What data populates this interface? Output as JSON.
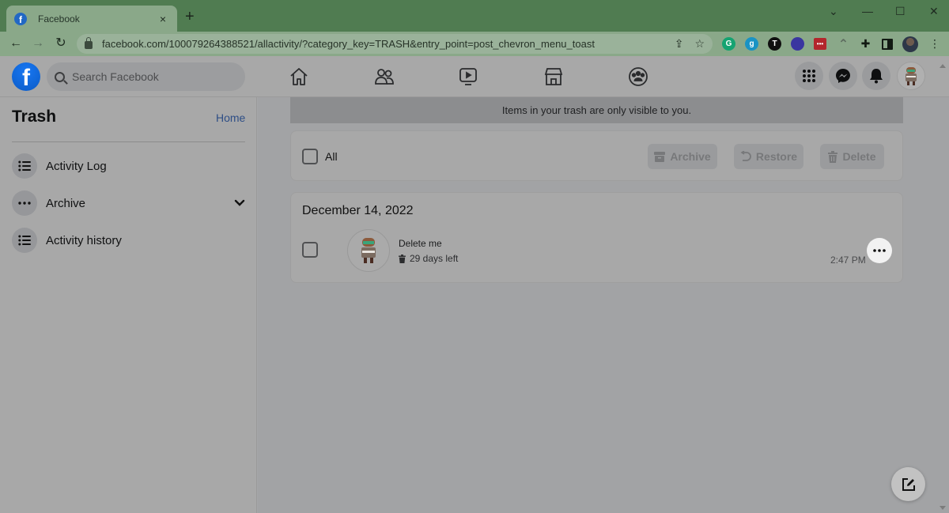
{
  "browser": {
    "tab": {
      "title": "Facebook",
      "favicon": "facebook-favicon",
      "close_icon": "×"
    },
    "new_tab_icon": "+",
    "window_controls": {
      "tab_search": "⌄",
      "minimize": "—",
      "maximize": "☐",
      "close": "✕"
    },
    "nav": {
      "back": "←",
      "forward": "→",
      "reload": "↻"
    },
    "url": "facebook.com/100079264388521/allactivity/?category_key=TRASH&entry_point=post_chevron_menu_toast",
    "omnibox_icons": {
      "share": "⇪",
      "bookmark": "☆"
    },
    "extensions": [
      {
        "name": "grammarly",
        "glyph": "G"
      },
      {
        "name": "g9",
        "glyph": "g"
      },
      {
        "name": "t-extension",
        "glyph": "T"
      },
      {
        "name": "ball-extension",
        "glyph": ""
      },
      {
        "name": "lastpass",
        "glyph": "•••"
      },
      {
        "name": "arc-extension",
        "glyph": "⌃"
      },
      {
        "name": "extensions-puzzle",
        "glyph": "✚"
      }
    ],
    "menu_icon": "⋮"
  },
  "facebook": {
    "logo": "f",
    "search": {
      "placeholder": "Search Facebook"
    },
    "nav_tabs": [
      "home",
      "friends",
      "watch",
      "marketplace",
      "groups"
    ],
    "right_buttons": [
      "menu",
      "messenger",
      "notifications",
      "account"
    ]
  },
  "sidebar": {
    "title": "Trash",
    "home_link": "Home",
    "items": [
      {
        "label": "Activity Log",
        "icon": "list-icon",
        "glyph": "☰"
      },
      {
        "label": "Archive",
        "icon": "more-icon",
        "glyph": "•••",
        "chevron": "⌄"
      },
      {
        "label": "Activity history",
        "icon": "list-icon",
        "glyph": "☰"
      }
    ]
  },
  "main": {
    "banner": "Items in your trash are only visible to you.",
    "select_all_label": "All",
    "actions": {
      "archive": "Archive",
      "restore": "Restore",
      "delete": "Delete"
    },
    "groups": [
      {
        "date": "December 14, 2022",
        "entries": [
          {
            "title": "Delete me",
            "days_left": "29 days left",
            "time": "2:47 PM",
            "more": "•••"
          }
        ]
      }
    ]
  }
}
